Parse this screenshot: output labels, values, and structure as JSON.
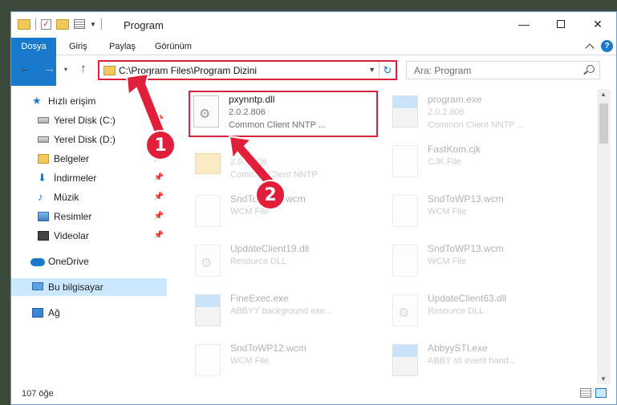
{
  "window": {
    "title": "Program",
    "controls": {
      "minimize": "—",
      "close": "✕"
    }
  },
  "ribbon": {
    "tabs": [
      "Dosya",
      "Giriş",
      "Paylaş",
      "Görünüm"
    ],
    "help": "?"
  },
  "nav": {
    "back": "←",
    "forward": "→",
    "dropdown": "▾",
    "up": "↑",
    "address": "C:\\Program Files\\Program Dizini",
    "search_placeholder": "Ara: Program"
  },
  "sidebar": {
    "items": [
      {
        "label": "Hızlı erişim",
        "icon": "star-icon",
        "pinned": false
      },
      {
        "label": "Yerel Disk (C:)",
        "icon": "disk-icon",
        "pinned": true
      },
      {
        "label": "Yerel Disk (D:)",
        "icon": "disk-icon",
        "pinned": false
      },
      {
        "label": "Belgeler",
        "icon": "documents-icon",
        "pinned": true
      },
      {
        "label": "İndirmeler",
        "icon": "downloads-icon",
        "pinned": true
      },
      {
        "label": "Müzik",
        "icon": "music-icon",
        "pinned": true
      },
      {
        "label": "Resimler",
        "icon": "pictures-icon",
        "pinned": true
      },
      {
        "label": "Videolar",
        "icon": "videos-icon",
        "pinned": true
      },
      {
        "label": "OneDrive",
        "icon": "cloud-icon",
        "pinned": false
      },
      {
        "label": "Bu bilgisayar",
        "icon": "computer-icon",
        "pinned": false,
        "selected": true
      },
      {
        "label": "Ağ",
        "icon": "network-icon",
        "pinned": false
      }
    ],
    "pin_glyph": "📌"
  },
  "files": [
    {
      "name": "pxynntp.dll",
      "version": "2.0.2.806",
      "desc": "Common Client NNTP ...",
      "type": "dll",
      "highlighted": true
    },
    {
      "name": "program.exe",
      "version": "2.0.2.806",
      "desc": "Common Client NNTP ...",
      "type": "exe"
    },
    {
      "name": "es",
      "version": "2.0.2.806",
      "desc": "Common Client NNTP",
      "type": "folder"
    },
    {
      "name": "FastKom.cjk",
      "version": "CJK File",
      "desc": "",
      "type": "file"
    },
    {
      "name": "SndToWP11.wcm",
      "version": "WCM File",
      "desc": "",
      "type": "file"
    },
    {
      "name": "SndToWP13.wcm",
      "version": "WCM File",
      "desc": "",
      "type": "file"
    },
    {
      "name": "UpdateClient19.dll",
      "version": "Resource DLL",
      "desc": "",
      "type": "dll"
    },
    {
      "name": "SndToWP13.wcm",
      "version": "WCM File",
      "desc": "",
      "type": "file"
    },
    {
      "name": "FineExec.exe",
      "version": "ABBYY background exe...",
      "desc": "",
      "type": "exe"
    },
    {
      "name": "UpdateClient63.dll",
      "version": "Resource DLL",
      "desc": "",
      "type": "dll"
    },
    {
      "name": "SndToWP12.wcm",
      "version": "WCM File",
      "desc": "",
      "type": "file"
    },
    {
      "name": "AbbyySTI.exe",
      "version": "ABBY sti event hand...",
      "desc": "",
      "type": "exe"
    }
  ],
  "status": {
    "count": "107 öğe"
  },
  "annotations": {
    "badge1": "1",
    "badge2": "2",
    "color": "#e0203a"
  },
  "colors": {
    "accent": "#1979ca",
    "highlight": "#e0203a",
    "selected_bg": "#cce8ff"
  }
}
